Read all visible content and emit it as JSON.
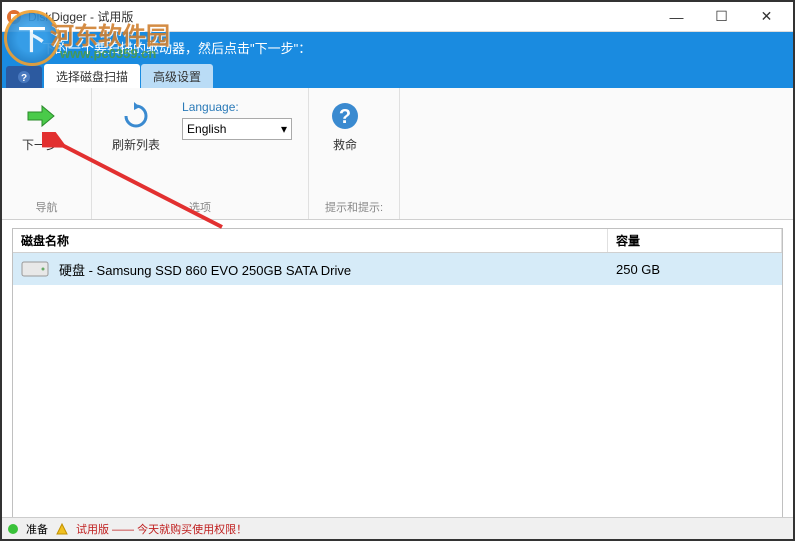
{
  "window": {
    "title": "DiskDigger - 试用版",
    "minimize": "—",
    "maximize": "☐",
    "close": "✕"
  },
  "watermark": {
    "badge": "下",
    "text": "河东软件园",
    "url": "www.pc0359.cn"
  },
  "banner": {
    "text": "下的一个要扫描的驱动器，然后点击\"下一步\"："
  },
  "tabs": {
    "help": "?",
    "scan": "选择磁盘扫描",
    "advanced": "高级设置"
  },
  "ribbon": {
    "group1": {
      "label": "导航",
      "next": "下一步"
    },
    "group2": {
      "label": "选项",
      "refresh": "刷新列表",
      "language_label": "Language:",
      "language_value": "English"
    },
    "group3": {
      "label": "提示和提示:",
      "help": "救命"
    }
  },
  "table": {
    "headers": {
      "name": "磁盘名称",
      "size": "容量"
    },
    "rows": [
      {
        "name": "硬盘 - Samsung SSD 860 EVO 250GB SATA Drive",
        "size": "250 GB"
      }
    ]
  },
  "statusbar": {
    "ready": "准备",
    "trial": "试用版 —— 今天就购买使用权限！"
  }
}
